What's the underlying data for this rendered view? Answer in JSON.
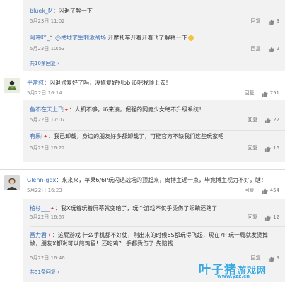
{
  "t1": {
    "replies": [
      {
        "name": "bluek_M",
        "text": "闪退了解一下",
        "date": "5月23日 11:02",
        "reply": "回复",
        "likes": "3"
      },
      {
        "name": "阿冲吖_",
        "mention": "@绝地求生刺激战场",
        "text": " 开摩托车开着开着飞了解释一下",
        "date": "5月23日 10:53",
        "reply": "回复",
        "likes": "2"
      }
    ],
    "more": "共10条回复 ›"
  },
  "t2": {
    "main": {
      "name": "平常怼",
      "text": "闪退修复好了吗，没修复好别bb i6吧我顶上去！",
      "date": "5月22日 16:14",
      "reply": "回复",
      "likes": "751"
    },
    "replies": [
      {
        "name": "鱼不在天上飞",
        "text": "人机不够，i6来凑，倔强的网瘾少女绝不升级系统！",
        "date": "5月22日 17:07",
        "reply": "回复",
        "likes": "22"
      },
      {
        "name": "有果i",
        "text": "我已卸载，身边的朋友好多都卸载了，可能官方不缺我们这些玩家吧",
        "date": "5月22日 16:22",
        "reply": "回复",
        "likes": "16"
      }
    ]
  },
  "t3": {
    "main": {
      "name": "Glenn-gqx",
      "text": "来来来，苹果6/6P玩闪退战场的顶起来，离博主近一点，毕竟博主视力不好，瞎！",
      "date": "5月22日 16:23",
      "reply": "回复",
      "likes": "454"
    },
    "replies": [
      {
        "name": "柏杉___",
        "text": "我X玩着玩着屏幕就变暗了，玩个游戏不仅手烫伤了眼睛还瞎了",
        "date": "5月22日 16:57",
        "reply": "回复",
        "likes": "12"
      },
      {
        "name": "吾力君",
        "text": "这屁游戏 什么手机都不好使，刚出来的时候6S都玩得飞起，现在7P 玩一局就发烫掉帧，朋友X都说可以煎鸡蛋！还吃鸡？ 手都烫伤了 先赔钱",
        "date": "5月22日 16:46",
        "reply": "回复",
        "likes": "9"
      }
    ],
    "more": "共51条回复 ›"
  },
  "watermark": {
    "line1": "叶子猪",
    "line2": "游戏网",
    "url": "www.yzz.cn"
  },
  "colors": {
    "link": "#3a6fb5",
    "reply_bg": "#f2f2f2",
    "badge": "#dd3333",
    "watermark": "#39a8e0"
  }
}
